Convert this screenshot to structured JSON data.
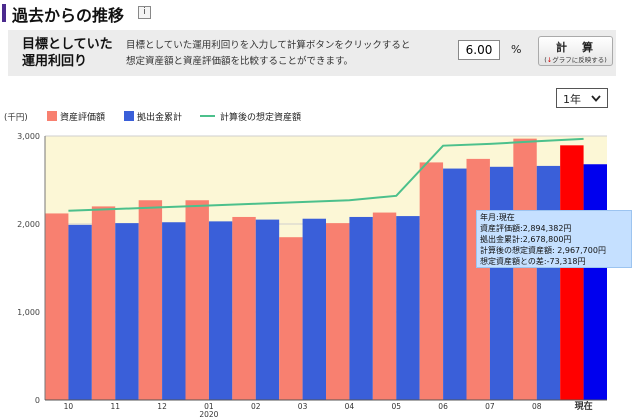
{
  "header": {
    "title": "過去からの推移",
    "info_icon": "info-icon"
  },
  "target": {
    "label_line1": "目標としていた",
    "label_line2": "運用利回り",
    "desc_line1": "目標としていた運用利回りを入力して計算ボタンをクリックすると",
    "desc_line2": "想定資産額と資産評価額を比較することができます。",
    "rate_value": "6.00",
    "rate_unit": "%",
    "calc_label": "計　算",
    "calc_sub_arrow": "↓",
    "calc_sub": "グラフに反映する"
  },
  "period": {
    "selected": "1年"
  },
  "tooltip": {
    "line1": "年月:現在",
    "line2": "資産評価額:2,894,382円",
    "line3": "拠出金累計:2,678,800円",
    "line4": "計算後の想定資産額: 2,967,700円",
    "line5": "想定資産額との差:-73,318円"
  },
  "colors": {
    "asset": "#f88070",
    "asset_highlight": "#ff0000",
    "contrib": "#3a5fd9",
    "contrib_highlight": "#0000ee",
    "line": "#4cc08c",
    "plot_bg": "#fcf7d6",
    "accent": "#4b2a8e"
  },
  "chart_data": {
    "type": "bar",
    "unit_label": "(千円)",
    "categories": [
      "10",
      "11",
      "12",
      "01",
      "02",
      "03",
      "04",
      "05",
      "06",
      "07",
      "08",
      "現在"
    ],
    "year_label": {
      "under": "01",
      "text": "2020"
    },
    "ylim": [
      0,
      3000
    ],
    "yticks": [
      0,
      1000,
      2000,
      3000
    ],
    "ytick_labels": [
      "0",
      "1,000",
      "2,000",
      "3,000"
    ],
    "highlight_index": 11,
    "series": [
      {
        "name": "資産評価額",
        "kind": "bar",
        "values": [
          2120,
          2200,
          2270,
          2270,
          2080,
          1850,
          2010,
          2130,
          2700,
          2740,
          2970,
          2894
        ]
      },
      {
        "name": "拠出金累計",
        "kind": "bar",
        "values": [
          1990,
          2010,
          2020,
          2030,
          2050,
          2060,
          2080,
          2090,
          2630,
          2650,
          2660,
          2679
        ]
      },
      {
        "name": "計算後の想定資産額",
        "kind": "line",
        "values": [
          2150,
          2170,
          2190,
          2210,
          2230,
          2250,
          2270,
          2320,
          2890,
          2910,
          2940,
          2968
        ]
      }
    ],
    "grid": true,
    "legend": "top-left"
  }
}
